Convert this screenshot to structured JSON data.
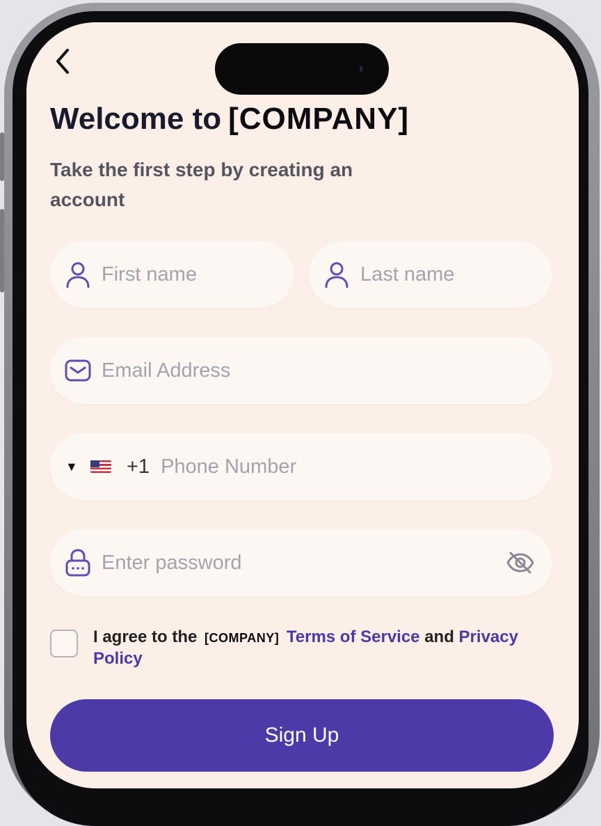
{
  "header": {
    "title": "Welcome to",
    "brand": "[COMPANY]",
    "subtitle": "Take the first step by creating an account"
  },
  "form": {
    "first_name_placeholder": "First name",
    "last_name_placeholder": "Last name",
    "email_placeholder": "Email Address",
    "phone_dial_code": "+1",
    "phone_placeholder": "Phone Number",
    "password_placeholder": "Enter password"
  },
  "agreement": {
    "checked": false,
    "prefix": "I agree to the",
    "brand": "[COMPANY]",
    "terms_link": "Terms of Service",
    "conjunction": "and",
    "privacy_link": "Privacy Policy"
  },
  "actions": {
    "signup_label": "Sign Up"
  },
  "colors": {
    "accent": "#4b3aa7",
    "link": "#4a3aa8",
    "background": "#fbefe7",
    "field": "#fdf7f3"
  },
  "icons": {
    "back": "chevron-left-icon",
    "first_name": "user-icon",
    "last_name": "user-icon",
    "email": "mail-icon",
    "country": "us-flag-icon",
    "password": "lock-icon",
    "visibility": "eye-off-icon"
  }
}
